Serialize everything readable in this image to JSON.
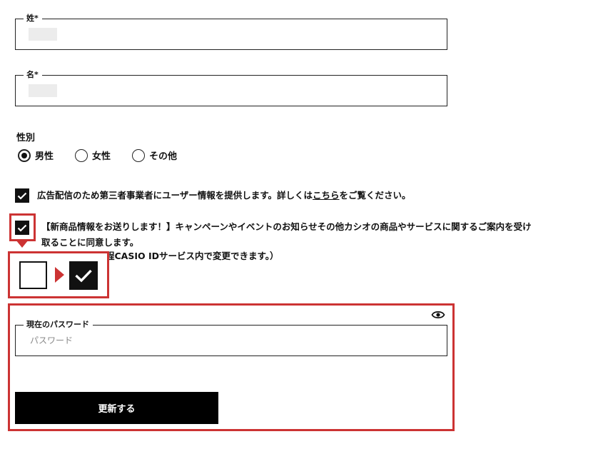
{
  "last_name": {
    "label": "姓*",
    "value": ""
  },
  "first_name": {
    "label": "名*",
    "value": ""
  },
  "gender": {
    "label": "性別",
    "options": [
      {
        "label": "男性",
        "checked": true
      },
      {
        "label": "女性",
        "checked": false
      },
      {
        "label": "その他",
        "checked": false
      }
    ]
  },
  "consent_ads": {
    "text_before": "広告配信のため第三者事業者にユーザー情報を提供します。詳しくは",
    "link": "こちら",
    "text_after": "をご覧ください。",
    "checked": true
  },
  "consent_news": {
    "line1": "【新商品情報をお送りします！】キャンペーンやイベントのお知らせその他カシオの商品やサービスに関するご案内を受け",
    "line2": "取ることに同意します。",
    "line3": "程CASIO IDサービス内で変更できます。）",
    "checked": true
  },
  "password": {
    "label": "現在のパスワード",
    "placeholder": "パスワード",
    "eye_icon": "eye-icon"
  },
  "submit": {
    "label": "更新する"
  },
  "colors": {
    "highlight": "#cc3333",
    "button_bg": "#000000"
  }
}
